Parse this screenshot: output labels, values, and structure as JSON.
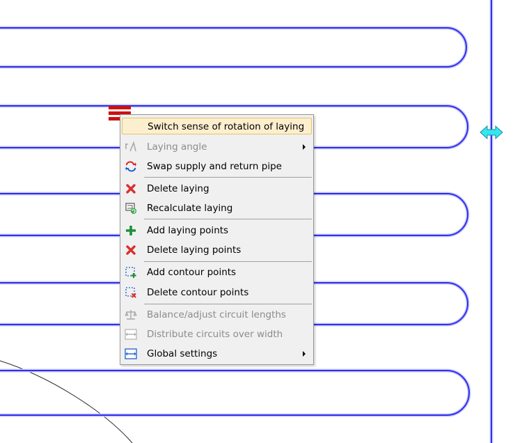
{
  "menu": {
    "items": [
      {
        "label": "Switch sense of rotation of laying",
        "icon": "rotation-icon",
        "enabled": true
      },
      {
        "label": "Laying angle",
        "icon": "laying-angle-icon",
        "enabled": false,
        "submenu": true
      },
      {
        "label": "Swap supply and return pipe",
        "icon": "swap-pipes-icon",
        "enabled": true
      },
      {
        "label": "Delete laying",
        "icon": "delete-icon",
        "enabled": true
      },
      {
        "label": "Recalculate laying",
        "icon": "recalculate-icon",
        "enabled": true
      },
      {
        "label": "Add laying points",
        "icon": "add-icon",
        "enabled": true
      },
      {
        "label": "Delete laying points",
        "icon": "delete-icon",
        "enabled": true
      },
      {
        "label": "Add contour points",
        "icon": "add-contour-points-icon",
        "enabled": true
      },
      {
        "label": "Delete contour points",
        "icon": "delete-contour-points-icon",
        "enabled": true
      },
      {
        "label": "Balance/adjust circuit lengths",
        "icon": "balance-icon",
        "enabled": false
      },
      {
        "label": "Distribute circuits over width",
        "icon": "distribute-width-icon",
        "enabled": false
      },
      {
        "label": "Global settings",
        "icon": "global-settings-icon",
        "enabled": true,
        "submenu": true
      }
    ],
    "highlighted_index": 0
  },
  "colors": {
    "pipe": "#2f2fe8",
    "pipe_glow": "#c9c9ff",
    "handle_red": "#cc1111",
    "handle_cyan": "#33e6f0",
    "menu_bg": "#f0f0f0",
    "highlight_bg": "#fcefcf",
    "highlight_border": "#e5c365"
  }
}
